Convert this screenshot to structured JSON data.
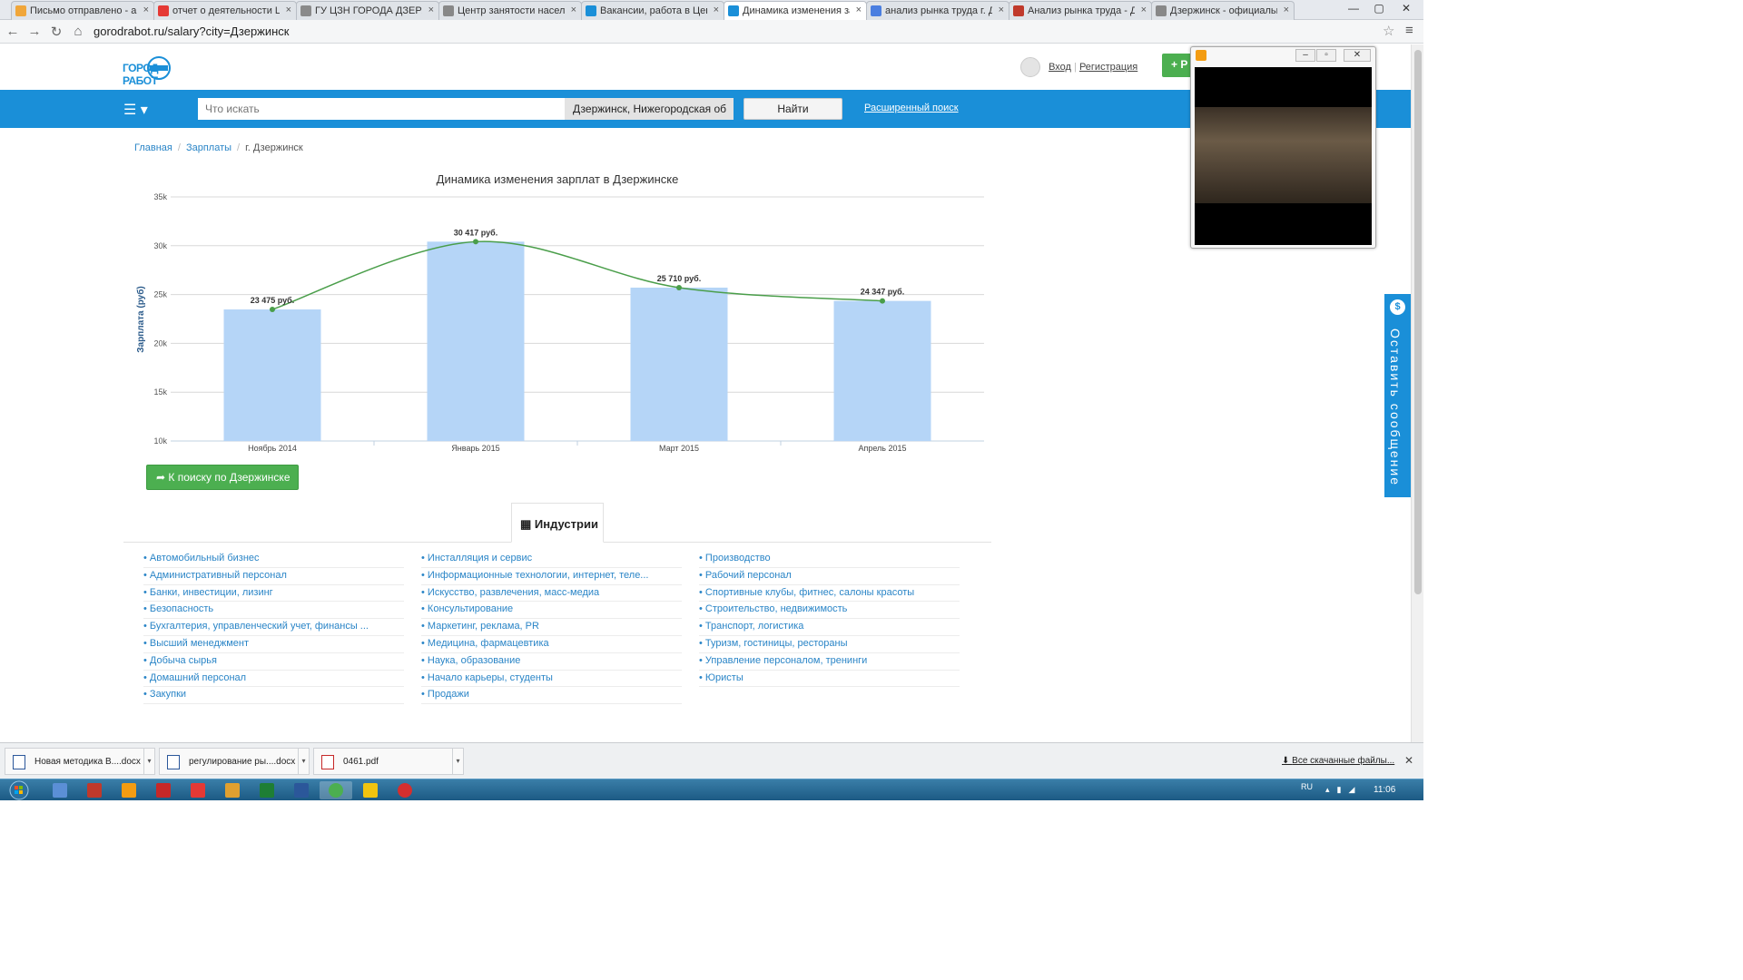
{
  "tabs": [
    {
      "label": "Письмо отправлено - an",
      "icon": "mail-icon",
      "color": "#f0a63a"
    },
    {
      "label": "отчет о деятельности Ц",
      "icon": "yandex-icon",
      "color": "#e53935"
    },
    {
      "label": "ГУ ЦЗН ГОРОДА ДЗЕРЖ",
      "icon": "clip-icon",
      "color": "#8a8a8a"
    },
    {
      "label": "Центр занятости насел",
      "icon": "page-icon",
      "color": "#888888"
    },
    {
      "label": "Вакансии, работа в Цент",
      "icon": "gorodrabot-icon",
      "color": "#1a8fd8"
    },
    {
      "label": "Динамика изменения зар",
      "icon": "gorodrabot-icon",
      "color": "#1a8fd8",
      "active": true
    },
    {
      "label": "анализ рынка труда г. Дз",
      "icon": "google-icon",
      "color": "#4a7ee0"
    },
    {
      "label": "Анализ рынка труда - Дз",
      "icon": "shield-icon",
      "color": "#c0392b"
    },
    {
      "label": "Дзержинск - официальн",
      "icon": "page-icon",
      "color": "#888888"
    }
  ],
  "address": "gorodrabot.ru/salary?city=Дзержинск",
  "header": {
    "logo": "ГОРОД РАБОТ",
    "login": "Вход",
    "register": "Регистрация",
    "green_button": "+ Р"
  },
  "search": {
    "placeholder": "Что искать",
    "city": "Дзержинск, Нижегородская об",
    "find": "Найти",
    "advanced": "Расширенный поиск"
  },
  "breadcrumb": {
    "home": "Главная",
    "salaries": "Зарплаты",
    "current": "г. Дзержинск"
  },
  "chart_data": {
    "type": "bar",
    "title": "Динамика изменения зарплат в Дзержинске",
    "xlabel": "",
    "ylabel": "Зарплата (руб)",
    "ylim": [
      10000,
      35000
    ],
    "yticks": [
      10000,
      15000,
      20000,
      25000,
      30000,
      35000
    ],
    "ytick_labels": [
      "10k",
      "15k",
      "20k",
      "25k",
      "30k",
      "35k"
    ],
    "categories": [
      "Ноябрь 2014",
      "Январь 2015",
      "Март 2015",
      "Апрель 2015"
    ],
    "values": [
      23475,
      30417,
      25710,
      24347
    ],
    "data_labels": [
      "23 475 руб.",
      "30 417 руб.",
      "25 710 руб.",
      "24 347 руб."
    ],
    "overlay_line": true,
    "grid": true,
    "bar_color": "#b5d5f7",
    "line_color": "#4a9e4a"
  },
  "back_button": "К поиску по Дзержинске",
  "industries_tab": "Индустрии",
  "industries": [
    [
      "Автомобильный бизнес",
      "Административный персонал",
      "Банки, инвестиции, лизинг",
      "Безопасность",
      "Бухгалтерия, управленческий учет, финансы ...",
      "Высший менеджмент",
      "Добыча сырья",
      "Домашний персонал",
      "Закупки"
    ],
    [
      "Инсталляция и сервис",
      "Информационные технологии, интернет, теле...",
      "Искусство, развлечения, масс-медиа",
      "Консультирование",
      "Маркетинг, реклама, PR",
      "Медицина, фармацевтика",
      "Наука, образование",
      "Начало карьеры, студенты",
      "Продажи"
    ],
    [
      "Производство",
      "Рабочий персонал",
      "Спортивные клубы, фитнес, салоны красоты",
      "Строительство, недвижимость",
      "Транспорт, логистика",
      "Туризм, гостиницы, рестораны",
      "Управление персоналом, тренинги",
      "Юристы"
    ]
  ],
  "feedback": "Оставить сообщение",
  "downloads": [
    {
      "name": "Новая методика В....docx",
      "icon": "word-icon"
    },
    {
      "name": "регулирование ры....docx",
      "icon": "word-icon"
    },
    {
      "name": "0461.pdf",
      "icon": "pdf-icon"
    }
  ],
  "all_downloads": "Все скачанные файлы...",
  "taskbar": {
    "lang": "RU",
    "time": "11:06"
  }
}
